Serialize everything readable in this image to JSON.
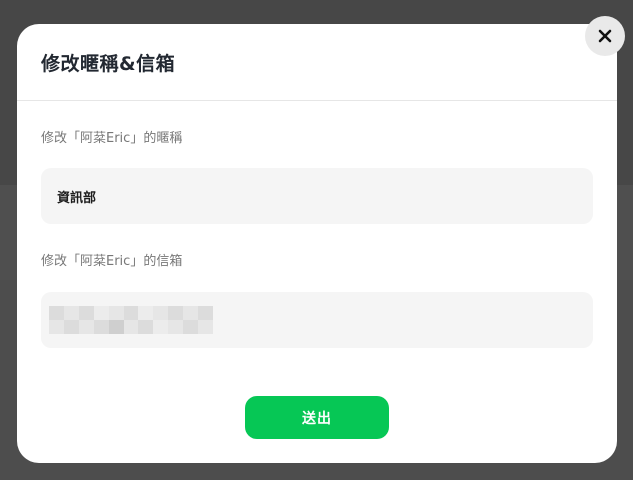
{
  "dialog": {
    "title": "修改暱稱&信箱",
    "close_icon": "close-icon"
  },
  "form": {
    "nickname_label": "修改「阿棻Eric」的暱稱",
    "nickname_value": "資訊部",
    "email_label": "修改「阿棻Eric」的信箱",
    "email_value_state": "redacted"
  },
  "actions": {
    "submit_label": "送出"
  },
  "colors": {
    "accent": "#06c755",
    "field_background": "#f5f5f5",
    "overlay": "#4a4a4a"
  }
}
